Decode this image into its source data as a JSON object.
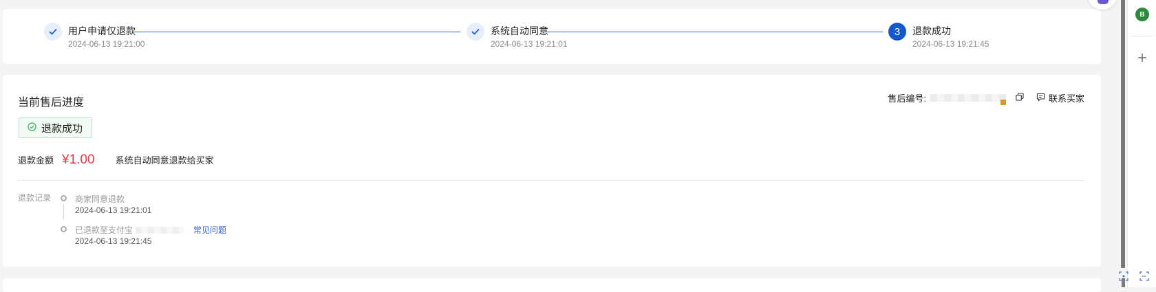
{
  "steps": [
    {
      "title": "用户申请仅退款",
      "time": "2024-06-13 19:21:00",
      "state": "done"
    },
    {
      "title": "系统自动同意",
      "time": "2024-06-13 19:21:01",
      "state": "done"
    },
    {
      "title": "退款成功",
      "time": "2024-06-13 19:21:45",
      "state": "current",
      "number": "3"
    }
  ],
  "progress": {
    "title": "当前售后进度",
    "aftersale_label": "售后编号:",
    "contact_label": "联系买家",
    "status": "退款成功",
    "amount_label": "退款金额",
    "amount_value": "¥1.00",
    "amount_desc": "系统自动同意退款给买家",
    "record_label": "退款记录",
    "records": [
      {
        "title": "商家同意退款",
        "time": "2024-06-13 19:21:01"
      },
      {
        "title": "已退款至支付宝",
        "time": "2024-06-13 19:21:45",
        "link": "常见问题"
      }
    ]
  },
  "side_panel": {
    "avatar_letter": "B"
  },
  "colors": {
    "accent": "#1458cc",
    "price_red": "#e8394a",
    "success_green": "#2fb35a",
    "link_blue": "#2d62d2"
  },
  "icons": [
    "check-icon",
    "copy-icon",
    "chat-icon",
    "success-circle-icon",
    "plus-icon",
    "scan-icon",
    "screenshot-icon"
  ]
}
